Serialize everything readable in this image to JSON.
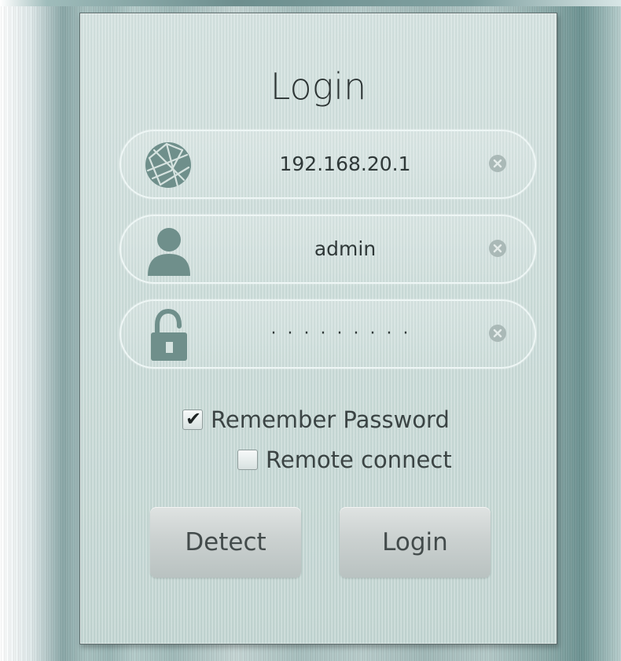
{
  "dialog": {
    "title": "Login"
  },
  "fields": {
    "ip": {
      "value": "192.168.20.1",
      "icon": "globe-icon"
    },
    "username": {
      "value": "admin",
      "icon": "user-icon"
    },
    "password": {
      "value": "·········",
      "icon": "padlock-icon"
    }
  },
  "options": {
    "remember_password": {
      "label": "Remember Password",
      "checked": true
    },
    "remote_connect": {
      "label": "Remote connect",
      "checked": false
    }
  },
  "buttons": {
    "detect_label": "Detect",
    "login_label": "Login"
  },
  "colors": {
    "panel_background": "#cadbd8",
    "field_border": "#eef6f5",
    "icon_color": "#6f8f8b",
    "text_color": "#2f3838"
  }
}
